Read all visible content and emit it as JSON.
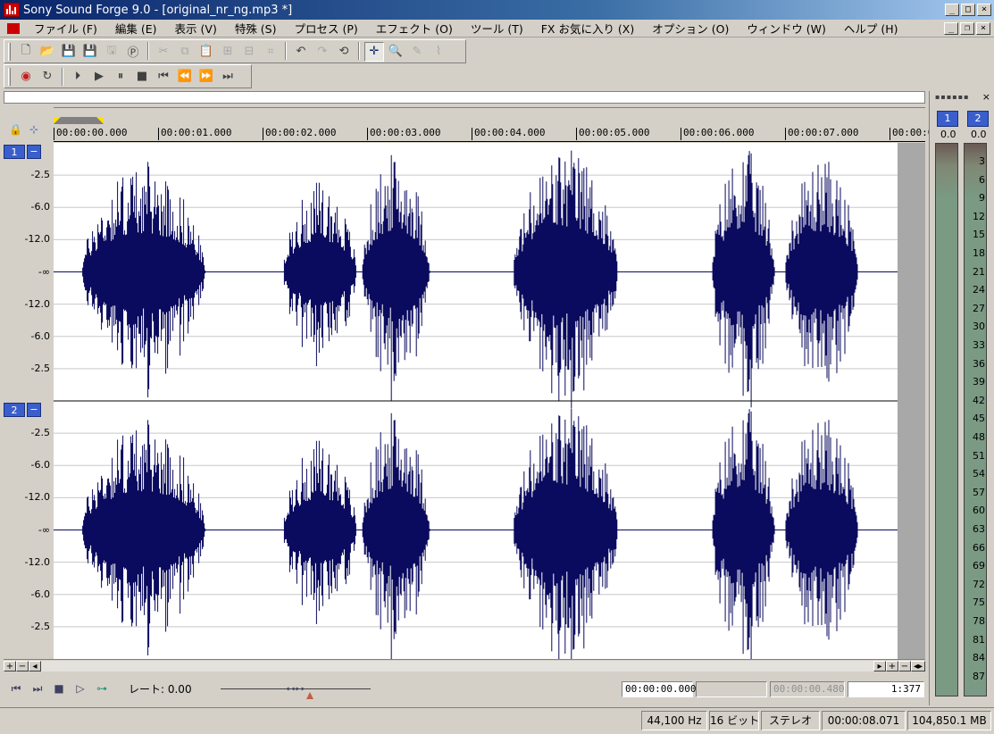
{
  "window": {
    "title": "Sony Sound Forge 9.0 - [original_nr_ng.mp3 *]",
    "buttons": [
      "_",
      "□",
      "×"
    ]
  },
  "menu": [
    "ファイル (F)",
    "編集 (E)",
    "表示 (V)",
    "特殊 (S)",
    "プロセス (P)",
    "エフェクト (O)",
    "ツール (T)",
    "FX お気に入り (X)",
    "オプション (O)",
    "ウィンドウ (W)",
    "ヘルプ (H)"
  ],
  "mdi_buttons": [
    "_",
    "❐",
    "×"
  ],
  "toolbar1": [
    {
      "name": "new-file-icon",
      "glyph": "🗋",
      "state": "normal"
    },
    {
      "name": "open-folder-icon",
      "glyph": "📂",
      "state": "normal"
    },
    {
      "name": "save-icon",
      "glyph": "💾",
      "state": "normal"
    },
    {
      "name": "save-as-icon",
      "glyph": "💾",
      "state": "normal"
    },
    {
      "name": "render-icon",
      "glyph": "🖫",
      "state": "dim"
    },
    {
      "name": "properties-icon",
      "glyph": "Ⓟ",
      "state": "normal"
    },
    {
      "name": "cut-icon",
      "glyph": "✂",
      "state": "dim"
    },
    {
      "name": "copy-icon",
      "glyph": "⧉",
      "state": "dim"
    },
    {
      "name": "paste-icon",
      "glyph": "📋",
      "state": "dim"
    },
    {
      "name": "mix-icon",
      "glyph": "⊞",
      "state": "dim"
    },
    {
      "name": "paste-special-icon",
      "glyph": "⊟",
      "state": "dim"
    },
    {
      "name": "trim-icon",
      "glyph": "⌗",
      "state": "dim"
    },
    {
      "name": "undo-icon",
      "glyph": "↶",
      "state": "normal"
    },
    {
      "name": "redo-icon",
      "glyph": "↷",
      "state": "dim"
    },
    {
      "name": "repeat-icon",
      "glyph": "⟲",
      "state": "normal"
    },
    {
      "name": "edit-tool-icon",
      "glyph": "✛",
      "state": "active"
    },
    {
      "name": "magnify-tool-icon",
      "glyph": "🔍",
      "state": "normal"
    },
    {
      "name": "pencil-tool-icon",
      "glyph": "✎",
      "state": "dim"
    },
    {
      "name": "envelope-tool-icon",
      "glyph": "⌇",
      "state": "dim"
    }
  ],
  "toolbar2": [
    {
      "name": "record-icon",
      "glyph": "◉"
    },
    {
      "name": "loop-icon",
      "glyph": "↻"
    },
    {
      "name": "play-all-icon",
      "glyph": "⏵"
    },
    {
      "name": "play-icon",
      "glyph": "▶"
    },
    {
      "name": "pause-icon",
      "glyph": "⏸"
    },
    {
      "name": "stop-icon",
      "glyph": "■"
    },
    {
      "name": "go-to-start-icon",
      "glyph": "⏮"
    },
    {
      "name": "rewind-icon",
      "glyph": "⏪"
    },
    {
      "name": "forward-icon",
      "glyph": "⏩"
    },
    {
      "name": "go-to-end-icon",
      "glyph": "⏭"
    }
  ],
  "ruler_ticks": [
    "00:00:00.000",
    "00:00:01.000",
    "00:00:02.000",
    "00:00:03.000",
    "00:00:04.000",
    "00:00:05.000",
    "00:00:06.000",
    "00:00:07.000",
    "00:00:0"
  ],
  "channels": [
    {
      "label": "1",
      "minus": "−",
      "db_labels": [
        "-2.5",
        "-6.0",
        "-12.0",
        "-∞",
        "-12.0",
        "-6.0",
        "-2.5"
      ]
    },
    {
      "label": "2",
      "minus": "−",
      "db_labels": [
        "-2.5",
        "-6.0",
        "-12.0",
        "-∞",
        "-12.0",
        "-6.0",
        "-2.5"
      ]
    }
  ],
  "hscroll": {
    "left": [
      "+",
      "−",
      "◂"
    ],
    "right": [
      "▸",
      "+",
      "−",
      "◂▸"
    ]
  },
  "transport": {
    "buttons": [
      {
        "name": "go-to-start-icon",
        "glyph": "⏮"
      },
      {
        "name": "go-to-end-icon",
        "glyph": "⏭"
      },
      {
        "name": "stop-icon",
        "glyph": "■"
      },
      {
        "name": "play-normal-icon",
        "glyph": "▷"
      },
      {
        "name": "scrub-icon",
        "glyph": "⊶"
      }
    ],
    "rate_label": "レート: 0.00",
    "slider_thumb": "◂◂▸▸"
  },
  "time_boxes": [
    {
      "value": "00:00:00.000",
      "state": "normal"
    },
    {
      "value": "",
      "state": "grey"
    },
    {
      "value": "00:00:00.480",
      "state": "grey"
    },
    {
      "value": "1:377",
      "state": "normal"
    }
  ],
  "status": [
    "44,100 Hz",
    "16 ビット",
    "ステレオ",
    "00:00:08.071",
    "104,850.1 MB"
  ],
  "meters": {
    "head": "▪▪▪▪▪▪",
    "close": "×",
    "channels": [
      "1",
      "2"
    ],
    "peaks": [
      "0.0",
      "0.0"
    ],
    "scale": [
      "3",
      "6",
      "9",
      "12",
      "15",
      "18",
      "21",
      "24",
      "27",
      "30",
      "33",
      "36",
      "39",
      "42",
      "45",
      "48",
      "51",
      "54",
      "57",
      "60",
      "63",
      "66",
      "69",
      "72",
      "75",
      "78",
      "81",
      "84",
      "87"
    ]
  },
  "waveform": {
    "color": "#0a0a5e",
    "duration_seconds": 8.071,
    "bursts": [
      {
        "start": 0.27,
        "end": 1.45,
        "peak": 0.88
      },
      {
        "start": 2.2,
        "end": 2.9,
        "peak": 0.72
      },
      {
        "start": 2.95,
        "end": 3.6,
        "peak": 0.95
      },
      {
        "start": 4.4,
        "end": 5.4,
        "peak": 1.0
      },
      {
        "start": 6.3,
        "end": 6.9,
        "peak": 1.0
      },
      {
        "start": 7.0,
        "end": 7.7,
        "peak": 0.92
      }
    ]
  }
}
